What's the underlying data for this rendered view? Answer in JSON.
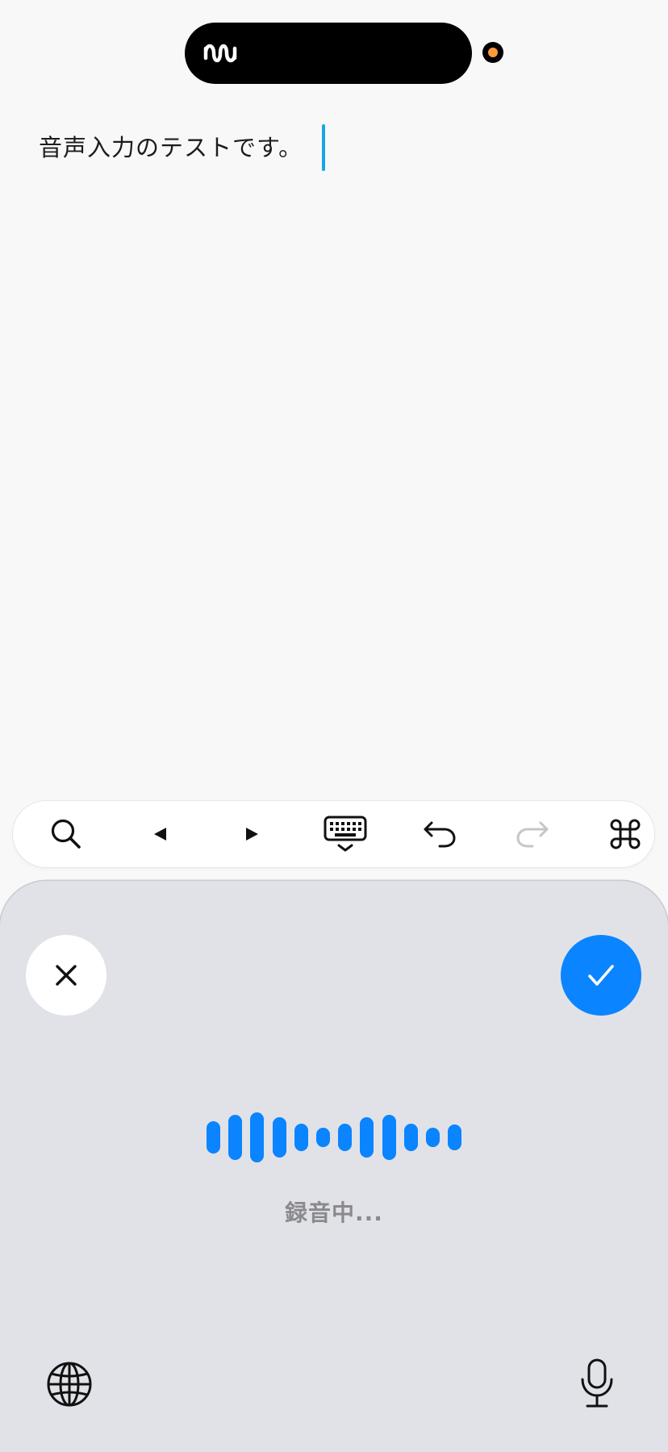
{
  "status_bar": {
    "live_activity_icon": "waveform-icon",
    "recording_indicator_color": "#ff9a3c"
  },
  "editor": {
    "text": "音声入力のテストです。",
    "caret_color": "#19a6e6"
  },
  "toolbar": {
    "items": [
      {
        "name": "search-button",
        "icon": "magnifier-icon"
      },
      {
        "name": "cursor-left-button",
        "icon": "triangle-left-icon"
      },
      {
        "name": "cursor-right-button",
        "icon": "triangle-right-icon"
      },
      {
        "name": "dismiss-keyboard-button",
        "icon": "keyboard-dismiss-icon"
      },
      {
        "name": "undo-button",
        "icon": "undo-arrow-icon"
      },
      {
        "name": "redo-button",
        "icon": "redo-arrow-icon",
        "disabled": true
      },
      {
        "name": "command-button",
        "icon": "command-icon"
      }
    ]
  },
  "voice_panel": {
    "cancel_icon": "close-icon",
    "confirm_icon": "checkmark-icon",
    "accent_color": "#0a84ff",
    "status_text": "録音中...",
    "globe_icon": "globe-icon",
    "mic_icon": "microphone-icon",
    "level_bars": [
      0.62,
      0.86,
      0.98,
      0.78,
      0.54,
      0.36,
      0.54,
      0.78,
      0.86,
      0.54,
      0.36,
      0.49
    ]
  }
}
